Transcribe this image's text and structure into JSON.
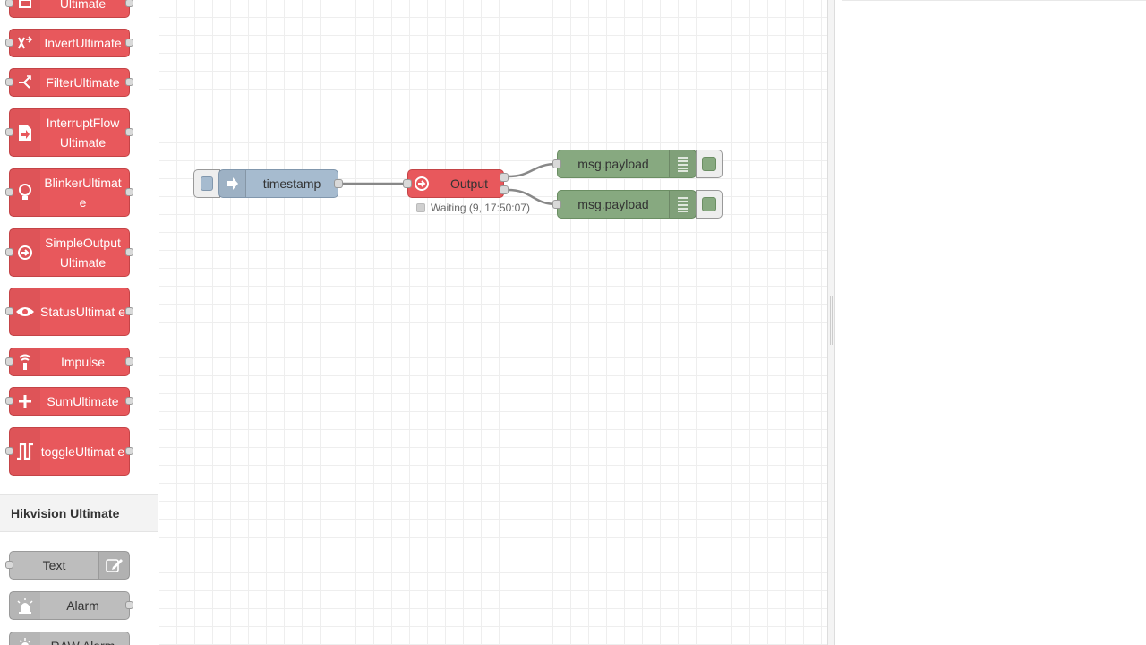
{
  "palette": {
    "nodes": [
      {
        "label": "Ultimate",
        "icon": "logic-icon"
      },
      {
        "label": "InvertUltimate",
        "icon": "shuffle-icon"
      },
      {
        "label": "FilterUltimate",
        "icon": "split-icon"
      },
      {
        "label": "InterruptFlow Ultimate",
        "icon": "document-arrow-icon"
      },
      {
        "label": "BlinkerUltimat e",
        "icon": "bulb-icon"
      },
      {
        "label": "SimpleOutput Ultimate",
        "icon": "arrow-circle-icon"
      },
      {
        "label": "StatusUltimat e",
        "icon": "eye-icon"
      },
      {
        "label": "Impulse",
        "icon": "broadcast-icon"
      },
      {
        "label": "SumUltimate",
        "icon": "plus-icon"
      },
      {
        "label": "toggleUltimat e",
        "icon": "square-wave-icon"
      }
    ],
    "category": "Hikvision Ultimate",
    "hik_nodes": [
      {
        "label": "Text",
        "icon": "edit-icon"
      },
      {
        "label": "Alarm",
        "icon": "alarm-light-icon"
      },
      {
        "label": "RAW Alarm",
        "icon": "sun-icon"
      }
    ]
  },
  "flow": {
    "inject": {
      "label": "timestamp"
    },
    "output": {
      "label": "Output",
      "status": "Waiting (9, 17:50:07)"
    },
    "debug1": {
      "label": "msg.payload"
    },
    "debug2": {
      "label": "msg.payload"
    }
  },
  "colors": {
    "red_node": "#e8585c",
    "inject_node": "#a6bbcf",
    "debug_node": "#87a980",
    "gray_node": "#bdbdbd"
  }
}
